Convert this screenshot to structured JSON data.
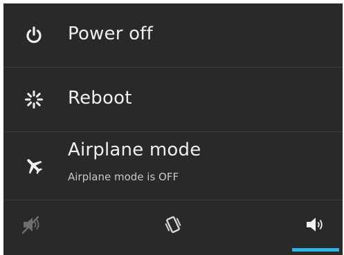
{
  "menu": {
    "items": [
      {
        "label": "Power off",
        "icon": "power-icon"
      },
      {
        "label": "Reboot",
        "icon": "reboot-icon"
      },
      {
        "label": "Airplane mode",
        "sublabel": "Airplane mode is OFF",
        "icon": "airplane-icon"
      }
    ]
  },
  "sound_modes": {
    "options": [
      {
        "icon": "speaker-muted-icon",
        "state": "silent"
      },
      {
        "icon": "vibrate-icon",
        "state": "vibrate"
      },
      {
        "icon": "speaker-on-icon",
        "state": "sound",
        "selected": true
      }
    ]
  },
  "colors": {
    "background": "#292929",
    "text": "#f0f0f0",
    "subtext": "#c8c8c8",
    "divider": "#3c3c3c",
    "accent": "#33b5e5"
  }
}
